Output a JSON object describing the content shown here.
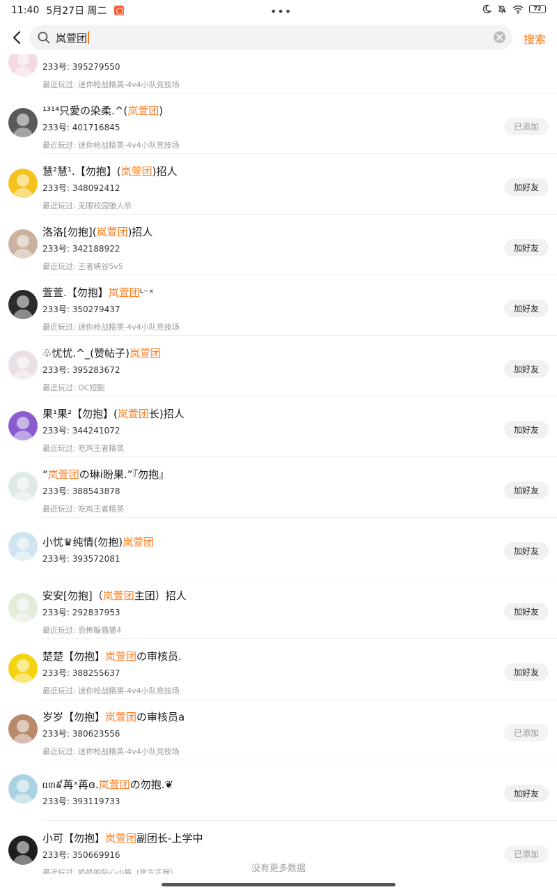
{
  "status": {
    "time": "11:40",
    "date": "5月27日 周二",
    "dots": "•••",
    "battery": "72"
  },
  "search": {
    "query": "岚萱团",
    "button": "搜索"
  },
  "colors": {
    "accent": "#ff7a1a",
    "muted": "#999999"
  },
  "results": [
    {
      "name_parts": [],
      "uid": "233号: 395279550",
      "recent": "最近玩过: 迷你枪战精英-4v4小队竞技场",
      "action": "",
      "action_state": "none",
      "avatar_color": "#f2d9e3"
    },
    {
      "name_parts": [
        {
          "t": "¹³¹⁴只愛の染柔.^(",
          "h": false
        },
        {
          "t": "岚萱团",
          "h": true
        },
        {
          "t": ")",
          "h": false
        }
      ],
      "uid": "233号: 401716845",
      "recent": "最近玩过: 迷你枪战精英-4v4小队竞技场",
      "action": "已添加",
      "action_state": "added",
      "avatar_color": "#5a5a5a"
    },
    {
      "name_parts": [
        {
          "t": "慧²慧¹.【勿抱】(",
          "h": false
        },
        {
          "t": "岚萱团",
          "h": true
        },
        {
          "t": ")招人",
          "h": false
        }
      ],
      "uid": "233号: 348092412",
      "recent": "最近玩过: 无限校园狼人杀",
      "action": "加好友",
      "action_state": "add",
      "avatar_color": "#f5c21b"
    },
    {
      "name_parts": [
        {
          "t": "洛洛[勿抱](",
          "h": false
        },
        {
          "t": "岚萱团",
          "h": true
        },
        {
          "t": ")招人",
          "h": false
        }
      ],
      "uid": "233号: 342188922",
      "recent": "最近玩过: 王者峡谷5v5",
      "action": "加好友",
      "action_state": "add",
      "avatar_color": "#c9b2a0"
    },
    {
      "name_parts": [
        {
          "t": "萱萱.【勿抱】",
          "h": false
        },
        {
          "t": "岚萱团",
          "h": true
        },
        {
          "t": "ᴸ⁻ˣ",
          "h": false
        }
      ],
      "uid": "233号: 350279437",
      "recent": "最近玩过: 迷你枪战精英-4v4小队竞技场",
      "action": "加好友",
      "action_state": "add",
      "avatar_color": "#2b2b2b"
    },
    {
      "name_parts": [
        {
          "t": "♧忧忧.^_(赞帖子)",
          "h": false
        },
        {
          "t": "岚萱团",
          "h": true
        }
      ],
      "uid": "233号: 395283672",
      "recent": "最近玩过: OC短剧",
      "action": "加好友",
      "action_state": "add",
      "avatar_color": "#eadfe6"
    },
    {
      "name_parts": [
        {
          "t": "果¹果²【勿抱】(",
          "h": false
        },
        {
          "t": "岚萱团",
          "h": true
        },
        {
          "t": "长)招人",
          "h": false
        }
      ],
      "uid": "233号: 344241072",
      "recent": "最近玩过: 吃鸡王者精英",
      "action": "加好友",
      "action_state": "add",
      "avatar_color": "#8a5ccf"
    },
    {
      "name_parts": [
        {
          "t": "“",
          "h": false
        },
        {
          "t": "岚萱团",
          "h": true
        },
        {
          "t": "の琳i盼果.”『勿抱』",
          "h": false
        }
      ],
      "uid": "233号: 388543878",
      "recent": "最近玩过: 吃鸡王者精英",
      "action": "加好友",
      "action_state": "add",
      "avatar_color": "#dfe9e6"
    },
    {
      "name_parts": [
        {
          "t": "小忧♛纯情(勿抱)",
          "h": false
        },
        {
          "t": "岚萱团",
          "h": true
        }
      ],
      "uid": "233号: 393572081",
      "recent": "",
      "action": "加好友",
      "action_state": "add",
      "avatar_color": "#cfe4ef"
    },
    {
      "name_parts": [
        {
          "t": "安安[勿抱]（",
          "h": false
        },
        {
          "t": "岚萱团",
          "h": true
        },
        {
          "t": "主团）招人",
          "h": false
        }
      ],
      "uid": "233号: 292837953",
      "recent": "最近玩过: 恐怖躲猫猫4",
      "action": "加好友",
      "action_state": "add",
      "avatar_color": "#e3ecd9"
    },
    {
      "name_parts": [
        {
          "t": "楚楚【勿抱】",
          "h": false
        },
        {
          "t": "岚萱团",
          "h": true
        },
        {
          "t": "の审核员.",
          "h": false
        }
      ],
      "uid": "233号: 388255637",
      "recent": "最近玩过: 迷你枪战精英-4v4小队竞技场",
      "action": "加好友",
      "action_state": "add",
      "avatar_color": "#f4d313"
    },
    {
      "name_parts": [
        {
          "t": "岁岁【勿抱】",
          "h": false
        },
        {
          "t": "岚萱团",
          "h": true
        },
        {
          "t": "の审核员a",
          "h": false
        }
      ],
      "uid": "233号: 380623556",
      "recent": "最近玩过: 迷你枪战精英-4v4小队竞技场",
      "action": "已添加",
      "action_state": "added",
      "avatar_color": "#b98a6a"
    },
    {
      "name_parts": [
        {
          "t": "ᥲᥖ៩苒ˣ苒ɞ.",
          "h": false
        },
        {
          "t": "岚萱团",
          "h": true
        },
        {
          "t": "の勿抱.❦",
          "h": false
        }
      ],
      "uid": "233号: 393119733",
      "recent": "",
      "action": "加好友",
      "action_state": "add",
      "avatar_color": "#a9d3e0"
    },
    {
      "name_parts": [
        {
          "t": "小可【勿抱】",
          "h": false
        },
        {
          "t": "岚萱团",
          "h": true
        },
        {
          "t": "副团长-上学中",
          "h": false
        }
      ],
      "uid": "233号: 350669916",
      "recent": "最近玩过: 奶奶的贴心小猫（官方正版）",
      "action": "已添加",
      "action_state": "added",
      "avatar_color": "#1e1e1e"
    }
  ],
  "footer": {
    "no_more": "没有更多数据"
  }
}
